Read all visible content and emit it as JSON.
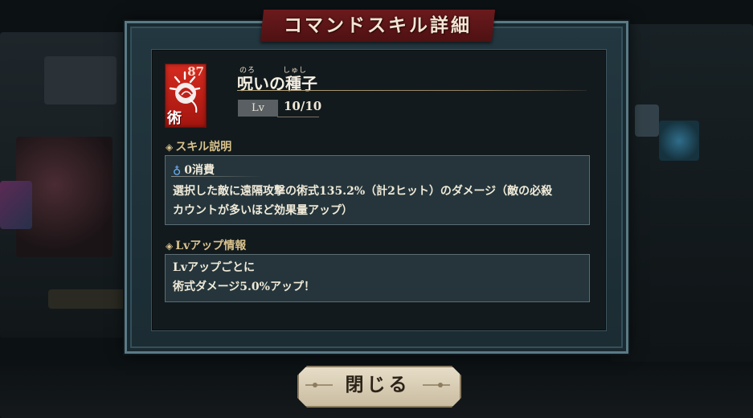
{
  "dialog": {
    "title": "コマンドスキル詳細"
  },
  "skill": {
    "icon_kanji": "術",
    "icon_corner": "87",
    "name": "呪いの種子",
    "ruby_1": "のろ",
    "ruby_2": "しゅし",
    "lv_label": "Lv",
    "lv_value": "10/10"
  },
  "skill_description": {
    "heading": "スキル説明",
    "cost": "0消費",
    "line1": "選択した敵に遠隔攻撃の術式135.2%（計2ヒット）のダメージ（敵の必殺",
    "line2": "カウントが多いほど効果量アップ）"
  },
  "lv_up_info": {
    "heading": "Lvアップ情報",
    "line1": "Lvアップごとに",
    "line2": "術式ダメージ5.0%アップ！"
  },
  "close_button": {
    "label": "閉じる"
  },
  "icons": {
    "skill": "seed-curse-icon",
    "diamond": "diamond-icon",
    "cost": "water-drop-icon"
  },
  "colors": {
    "title_banner": "#5e1517",
    "skill_icon_bg": "#c8231a",
    "heading": "#d9c28c",
    "cost_drop": "#6fb6ff"
  }
}
